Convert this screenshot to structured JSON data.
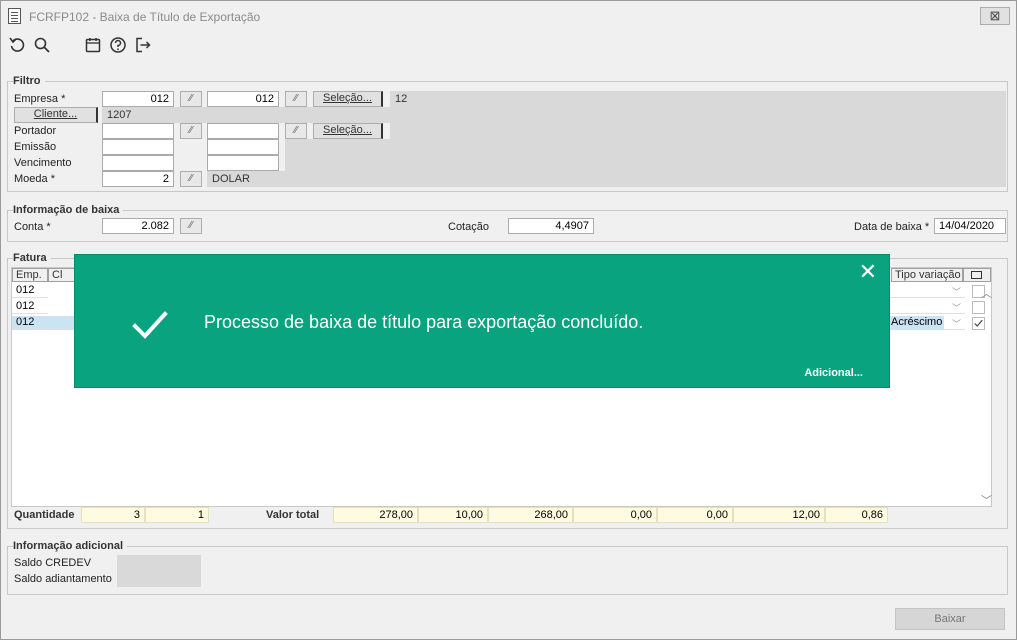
{
  "window": {
    "title": "FCRFP102 - Baixa de Título de Exportação",
    "close_glyph": "⊠"
  },
  "toolbar": {
    "icons": [
      "undo-icon",
      "search-icon",
      "calendar-icon",
      "help-icon",
      "exit-icon"
    ]
  },
  "filtro": {
    "legend": "Filtro",
    "empresa_label": "Empresa *",
    "empresa_from": "012",
    "empresa_to": "012",
    "selecao1_label": "Seleção...",
    "empresa_desc": "12",
    "cliente_button": "Cliente...",
    "cliente_value": "1207",
    "portador_label": "Portador",
    "selecao2_label": "Seleção...",
    "emissao_label": "Emissão",
    "vencimento_label": "Vencimento",
    "moeda_label": "Moeda *",
    "moeda_value": "2",
    "moeda_desc": "DOLAR"
  },
  "info_baixa": {
    "legend": "Informação de baixa",
    "conta_label": "Conta *",
    "conta_value": "2.082",
    "cotacao_label": "Cotação",
    "cotacao_value": "4,4907",
    "data_label": "Data de baixa *",
    "data_value": "14/04/2020"
  },
  "fatura": {
    "legend": "Fatura",
    "col_emp": "Emp.",
    "col_cl": "Cl",
    "col_tipo": "Tipo variação",
    "rows": [
      {
        "emp": "012",
        "tipo": "",
        "checked": false
      },
      {
        "emp": "012",
        "tipo": "",
        "checked": false
      },
      {
        "emp": "012",
        "tipo": "Acréscimo",
        "checked": true
      }
    ],
    "quantidade_label": "Quantidade",
    "quantidade_1": "3",
    "quantidade_2": "1",
    "valor_total_label": "Valor total",
    "totals": [
      "278,00",
      "10,00",
      "268,00",
      "0,00",
      "0,00",
      "12,00",
      "0,86"
    ]
  },
  "info_adicional": {
    "legend": "Informação adicional",
    "saldo_credev_label": "Saldo CREDEV",
    "saldo_adiantamento_label": "Saldo adiantamento"
  },
  "toast": {
    "message": "Processo de baixa de título para exportação concluído.",
    "more_link": "Adicional...",
    "close_glyph": "✕",
    "color": "#0aa37f"
  },
  "actions": {
    "baixar_label": "Baixar"
  }
}
